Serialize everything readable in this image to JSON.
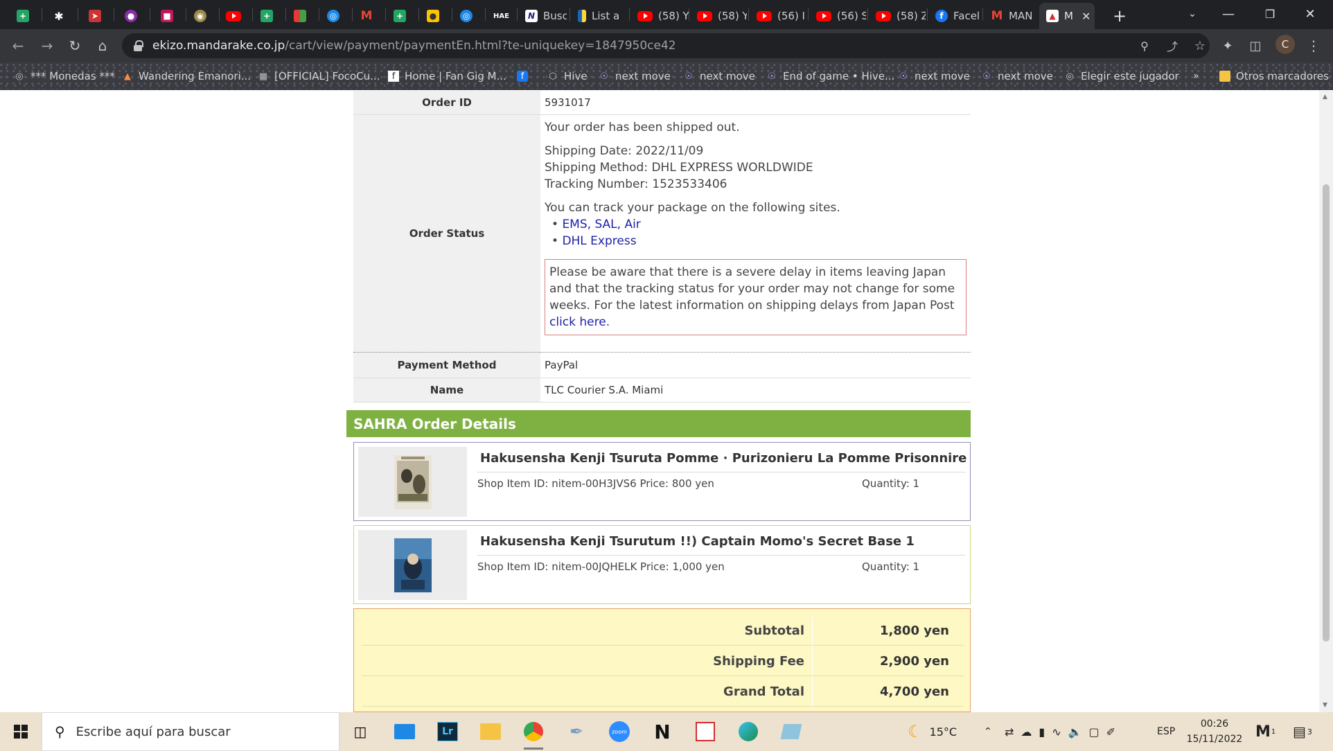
{
  "browser": {
    "tabs": [
      {
        "icon": "sheets-icon",
        "title": ""
      },
      {
        "icon": "runner-icon",
        "title": ""
      },
      {
        "icon": "pin-icon",
        "title": ""
      },
      {
        "icon": "hive-icon",
        "title": ""
      },
      {
        "icon": "cards-icon",
        "title": ""
      },
      {
        "icon": "coin-icon",
        "title": ""
      },
      {
        "icon": "youtube-icon",
        "title": ""
      },
      {
        "icon": "sheets-icon",
        "title": ""
      },
      {
        "icon": "tiles-icon",
        "title": ""
      },
      {
        "icon": "globe-icon",
        "title": ""
      },
      {
        "icon": "gmail-icon",
        "title": ""
      },
      {
        "icon": "sheets-icon",
        "title": ""
      },
      {
        "icon": "hippo-icon",
        "title": ""
      },
      {
        "icon": "globe-icon",
        "title": ""
      },
      {
        "icon": "hae-icon",
        "title": "HAE"
      },
      {
        "icon": "notion-icon",
        "title": "Busc"
      },
      {
        "icon": "flag-icon",
        "title": "List a"
      },
      {
        "icon": "youtube-icon",
        "title": "(58) Y"
      },
      {
        "icon": "youtube-icon",
        "title": "(58) Y"
      },
      {
        "icon": "youtube-icon",
        "title": "(56) I"
      },
      {
        "icon": "youtube-icon",
        "title": "(56) S"
      },
      {
        "icon": "youtube-icon",
        "title": "(58) Z"
      },
      {
        "icon": "facebook-icon",
        "title": "Facel"
      },
      {
        "icon": "gmail-icon",
        "title": "MAN"
      },
      {
        "icon": "mandarake-icon",
        "title": "M"
      }
    ],
    "url_host": "ekizo.mandarake.co.jp",
    "url_path": "/cart/view/payment/paymentEn.html?te-uniquekey=1847950ce42",
    "profile_initial": "C",
    "bookmarks": [
      "*** Monedas ***",
      "Wandering Emanori...",
      "[OFFICIAL] FocoCu...",
      "Home | Fan Gig M...",
      "",
      "Hive",
      "next move",
      "next move",
      "End of game • Hive...",
      "next move",
      "next move",
      "Elegir este jugador"
    ],
    "bookmarks_overflow": "»",
    "other_bookmarks": "Otros marcadores"
  },
  "order": {
    "order_id_label": "Order ID",
    "order_id": "5931017",
    "status_label": "Order Status",
    "status_line": "Your order has been shipped out.",
    "shipping_date": "Shipping Date: 2022/11/09",
    "shipping_method": "Shipping Method: DHL EXPRESS WORLDWIDE",
    "tracking_number": "Tracking Number: 1523533406",
    "track_intro": "You can track your package on the following sites.",
    "track_links": [
      "EMS, SAL, Air",
      "DHL Express"
    ],
    "delay_notice": "Please be aware that there is a severe delay in items leaving Japan and that the tracking status for your order may not change for some weeks. For the latest information on shipping delays from Japan Post ",
    "delay_link": "click here",
    "payment_label": "Payment Method",
    "payment": "PayPal",
    "name_label": "Name",
    "name": "TLC Courier S.A. Miami"
  },
  "details": {
    "header": "SAHRA Order Details",
    "items": [
      {
        "title": "Hakusensha Kenji Tsuruta Pomme · Purizonieru La Pomme Prisonnire",
        "meta": "Shop Item ID: nitem-00H3JVS6 Price: 800 yen",
        "quantity": "Quantity: 1",
        "border_color": "#8f8fb8"
      },
      {
        "title": "Hakusensha Kenji Tsurutum !!) Captain Momo's Secret Base 1",
        "meta": "Shop Item ID: nitem-00JQHELK Price: 1,000 yen",
        "quantity": "Quantity: 1",
        "border_color": "#c8d67a"
      }
    ]
  },
  "totals": {
    "subtotal_label": "Subtotal",
    "subtotal": "1,800 yen",
    "shipping_label": "Shipping Fee",
    "shipping": "2,900 yen",
    "grand_label": "Grand Total",
    "grand": "4,700 yen"
  },
  "taskbar": {
    "search_placeholder": "Escribe aquí para buscar",
    "apps": [
      "task-view-icon",
      "mail-icon",
      "lightroom-icon",
      "file-explorer-icon",
      "chrome-icon",
      "paint-icon",
      "zoom-icon",
      "notion-icon",
      "acrobat-icon",
      "edge-icon",
      "notes-icon"
    ],
    "temperature": "15°C",
    "language": "ESP",
    "time": "00:26",
    "date": "15/11/2022",
    "notification_count": "3",
    "mail_badge": "1"
  }
}
